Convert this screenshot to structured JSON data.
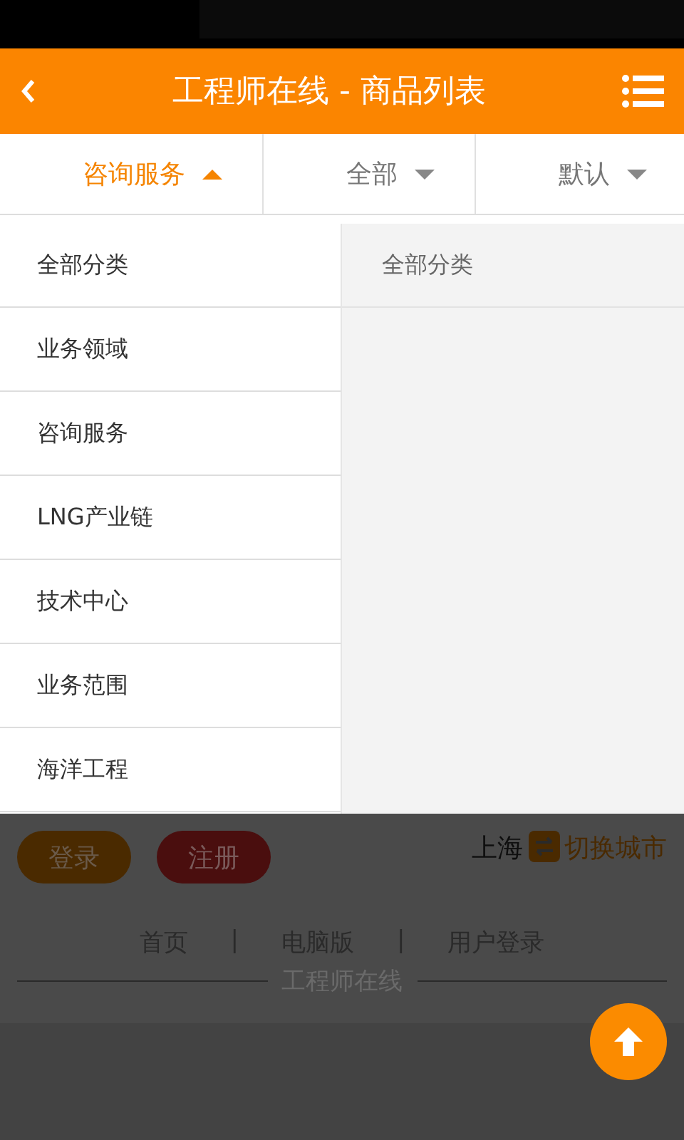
{
  "header": {
    "title": "工程师在线 - 商品列表"
  },
  "filters": [
    {
      "label": "咨询服务",
      "selected": true
    },
    {
      "label": "全部",
      "selected": false
    },
    {
      "label": "默认",
      "selected": false
    }
  ],
  "categories": [
    "全部分类",
    "业务领域",
    "咨询服务",
    "LNG产业链",
    "技术中心",
    "业务范围",
    "海洋工程"
  ],
  "subcategories": [
    "全部分类"
  ],
  "footer": {
    "login": "登录",
    "register": "注册",
    "city": "上海",
    "switch_city": "切换城市",
    "links": [
      "首页",
      "电脑版",
      "用户登录"
    ],
    "separator": "|",
    "brand": "工程师在线"
  }
}
